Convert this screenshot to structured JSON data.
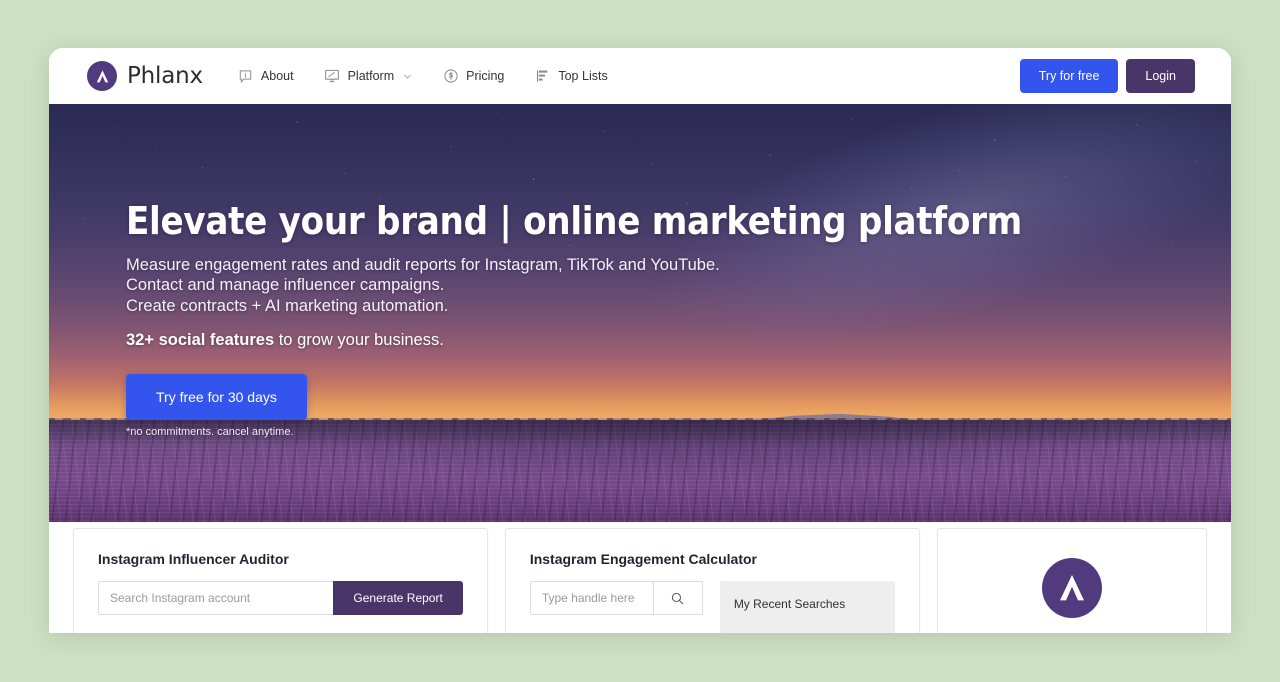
{
  "brand": {
    "name": "Phlanx",
    "logo_icon": "phlanx-chevron-logo",
    "logo_color": "#513a7e"
  },
  "nav": {
    "items": [
      {
        "label": "About",
        "icon": "info-speech-bubble-icon",
        "has_caret": false
      },
      {
        "label": "Platform",
        "icon": "monitor-icon",
        "has_caret": true
      },
      {
        "label": "Pricing",
        "icon": "dollar-circle-icon",
        "has_caret": false
      },
      {
        "label": "Top Lists",
        "icon": "ranked-list-icon",
        "has_caret": false
      }
    ],
    "try_label": "Try for free",
    "login_label": "Login",
    "try_color": "#3355ee",
    "login_color": "#4a3569"
  },
  "hero": {
    "title": "Elevate your brand | online marketing platform",
    "sub_lines": [
      "Measure engagement rates and audit reports for Instagram, TikTok and YouTube.",
      "Contact and manage influencer campaigns.",
      "Create contracts + AI marketing automation."
    ],
    "feature_strong": "32+ social features",
    "feature_rest": " to grow your business.",
    "cta_label": "Try free for 30 days",
    "note": "*no commitments. cancel anytime.",
    "cta_color": "#3355ee"
  },
  "cards": {
    "auditor": {
      "title": "Instagram Influencer Auditor",
      "input_placeholder": "Search Instagram account",
      "input_value": "",
      "button_label": "Generate Report",
      "button_color": "#4a3569"
    },
    "calculator": {
      "title": "Instagram Engagement Calculator",
      "input_placeholder": "Type handle here",
      "input_value": "",
      "search_icon": "magnifier-icon",
      "recent_label": "My Recent Searches"
    },
    "logo_card": {
      "logo_icon": "phlanx-chevron-logo"
    }
  },
  "page": {
    "background_color": "#cde0c4"
  }
}
